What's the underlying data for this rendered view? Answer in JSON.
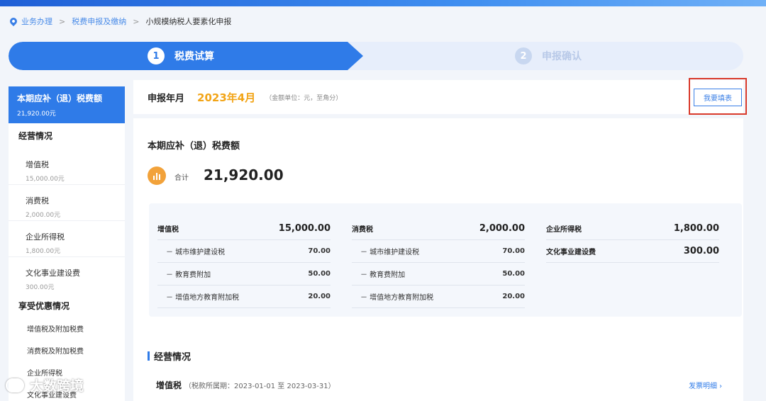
{
  "breadcrumb": {
    "items": [
      "业务办理",
      "税费申报及缴纳"
    ],
    "current": "小规模纳税人要素化申报"
  },
  "steps": [
    {
      "num": "1",
      "label": "税费试算"
    },
    {
      "num": "2",
      "label": "申报确认"
    }
  ],
  "sidebar": {
    "active": {
      "label": "本期应补（退）税费额",
      "value": "21,920.00元"
    },
    "group1": "经营情况",
    "items": [
      {
        "label": "增值税",
        "value": "15,000.00元"
      },
      {
        "label": "消费税",
        "value": "2,000.00元"
      },
      {
        "label": "企业所得税",
        "value": "1,800.00元"
      },
      {
        "label": "文化事业建设费",
        "value": "300.00元"
      }
    ],
    "group2": "享受优惠情况",
    "subitems": [
      "增值税及附加税费",
      "消费税及附加税费",
      "企业所得税",
      "文化事业建设费"
    ]
  },
  "period": {
    "label": "申报年月",
    "value": "2023年4月",
    "unit": "（金额单位：元，至角分）",
    "fill_button": "我要填表"
  },
  "summary": {
    "title": "本期应补（退）税费额",
    "total_label": "合计",
    "total_value": "21,920.00"
  },
  "breakdown": {
    "vat": {
      "name": "增值税",
      "amount": "15,000.00",
      "items": [
        {
          "name": "－ 城市维护建设税",
          "amount": "70.00"
        },
        {
          "name": "－ 教育费附加",
          "amount": "50.00"
        },
        {
          "name": "－ 增值地方教育附加税",
          "amount": "20.00"
        }
      ]
    },
    "consumption": {
      "name": "消费税",
      "amount": "2,000.00",
      "items": [
        {
          "name": "－ 城市维护建设税",
          "amount": "70.00"
        },
        {
          "name": "－ 教育费附加",
          "amount": "50.00"
        },
        {
          "name": "－ 增值地方教育附加税",
          "amount": "20.00"
        }
      ]
    },
    "cit": {
      "name": "企业所得税",
      "amount": "1,800.00"
    },
    "culture": {
      "name": "文化事业建设费",
      "amount": "300.00"
    }
  },
  "business": {
    "title": "经营情况",
    "vat_label": "增值税",
    "vat_period": "（税款所属期：2023-01-01 至 2023-03-31）",
    "invoice_link": "发票明细 ›"
  },
  "watermark": "大数跨境",
  "icons": {
    "location": "location-pin-icon",
    "total": "bar-chart-icon"
  },
  "colors": {
    "primary": "#2f7be8",
    "highlight": "#f2a416",
    "callout": "#d93a2b"
  }
}
